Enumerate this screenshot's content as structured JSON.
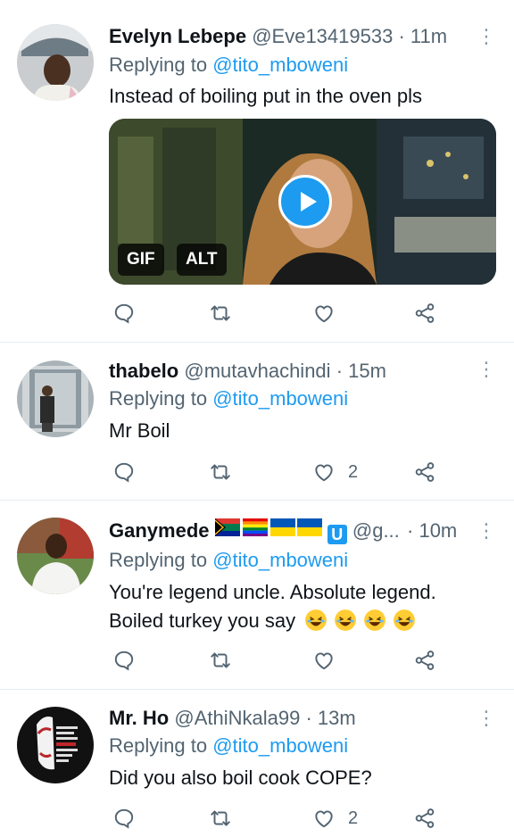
{
  "reply_prefix": "Replying to",
  "tweets": [
    {
      "name": "Evelyn Lebepe",
      "handle": "@Eve13419533",
      "separator": "·",
      "time": "11m",
      "replying_to": "@tito_mboweni",
      "text": "Instead of boiling put in the oven pls",
      "media": {
        "type": "gif",
        "gif_label": "GIF",
        "alt_label": "ALT"
      },
      "likes": ""
    },
    {
      "name": "thabelo",
      "handle": "@mutavhachindi",
      "separator": "·",
      "time": "15m",
      "replying_to": "@tito_mboweni",
      "text": "Mr Boil",
      "likes": "2"
    },
    {
      "name": "Ganymede",
      "handle": "@g...",
      "separator": "·",
      "time": "10m",
      "replying_to": "@tito_mboweni",
      "text_line1": "You're legend uncle. Absolute legend.",
      "text_line2": "Boiled turkey you say",
      "likes": ""
    },
    {
      "name": "Mr. Ho",
      "handle": "@AthiNkala99",
      "separator": "·",
      "time": "13m",
      "replying_to": "@tito_mboweni",
      "text": "Did you also boil cook COPE?",
      "likes": "2"
    }
  ],
  "icons": [
    "reply-icon",
    "retweet-icon",
    "like-icon",
    "share-icon",
    "more-icon"
  ],
  "colors": {
    "mention": "#1d9bf0",
    "secondary": "#536471",
    "play_button": "#1d9bf0"
  }
}
